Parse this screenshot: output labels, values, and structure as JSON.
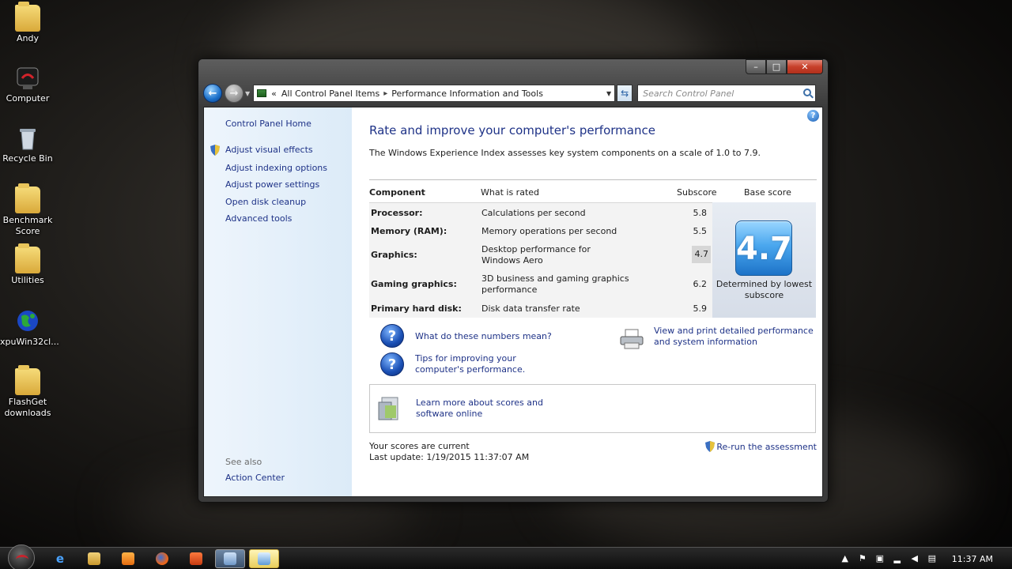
{
  "desktop": {
    "icons": [
      {
        "label": "Andy",
        "icon": "user-folder-icon"
      },
      {
        "label": "Computer",
        "icon": "computer-icon"
      },
      {
        "label": "Recycle Bin",
        "icon": "recycle-bin-icon"
      },
      {
        "label": "Benchmark Score",
        "icon": "folder-icon"
      },
      {
        "label": "Utilities",
        "icon": "folder-icon"
      },
      {
        "label": "xpuWin32cl...",
        "icon": "globe-icon"
      },
      {
        "label": "FlashGet downloads",
        "icon": "shortcut-folder-icon"
      }
    ]
  },
  "window": {
    "controls": {
      "min": "–",
      "max": "□",
      "close": "✕"
    },
    "address": {
      "prefix": "«",
      "crumb1": "All Control Panel Items",
      "separator": "▸",
      "crumb2": "Performance Information and Tools"
    },
    "search": {
      "placeholder": "Search Control Panel"
    },
    "help": "?"
  },
  "sidebar": {
    "home": "Control Panel Home",
    "links": [
      "Adjust visual effects",
      "Adjust indexing options",
      "Adjust power settings",
      "Open disk cleanup",
      "Advanced tools"
    ],
    "see_also_label": "See also",
    "see_also_links": [
      "Action Center"
    ]
  },
  "main": {
    "title": "Rate and improve your computer's performance",
    "subtitle": "The Windows Experience Index assesses key system components on a scale of 1.0 to 7.9.",
    "table": {
      "headers": [
        "Component",
        "What is rated",
        "Subscore",
        "Base score"
      ],
      "rows": [
        {
          "component": "Processor:",
          "rated": "Calculations per second",
          "subscore": "5.8"
        },
        {
          "component": "Memory (RAM):",
          "rated": "Memory operations per second",
          "subscore": "5.5"
        },
        {
          "component": "Graphics:",
          "rated": "Desktop performance for Windows Aero",
          "subscore": "4.7"
        },
        {
          "component": "Gaming graphics:",
          "rated": "3D business and gaming graphics performance",
          "subscore": "6.2"
        },
        {
          "component": "Primary hard disk:",
          "rated": "Disk data transfer rate",
          "subscore": "5.9"
        }
      ],
      "base_score": "4.7",
      "base_caption": "Determined by lowest subscore"
    },
    "links": {
      "numbers": "What do these numbers mean?",
      "tips": "Tips for improving your computer's performance.",
      "print": "View and print detailed performance and system information",
      "learn": "Learn more about scores and software online"
    },
    "status": {
      "current": "Your scores are current",
      "last_update": "Last update: 1/19/2015 11:37:07 AM"
    },
    "rerun": "Re-run the assessment"
  },
  "taskbar": {
    "clock": "11:37 AM",
    "items": [
      "internet-explorer-icon",
      "explorer-icon",
      "media-player-icon",
      "firefox-icon",
      "mail-icon",
      "control-panel-icon",
      "performance-tool-icon"
    ]
  },
  "colors": {
    "link": "#1e3287",
    "accent_tile": "#4aa7ee"
  }
}
